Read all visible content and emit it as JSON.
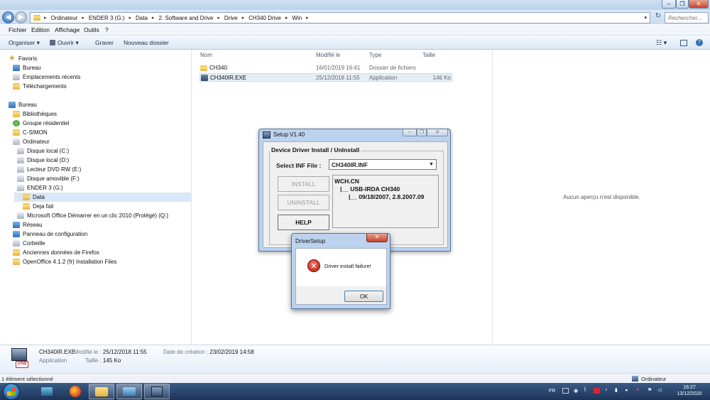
{
  "window": {
    "minimize": "–",
    "maximize": "❐",
    "close": "✕"
  },
  "address": {
    "crumbs": [
      "Ordinateur",
      "ENDER 3 (G:)",
      "Data",
      "2. Software and Drive",
      "Drive",
      "CH340 Drive",
      "Win"
    ],
    "search_placeholder": "Rechercher..."
  },
  "menu": [
    "Fichier",
    "Edition",
    "Affichage",
    "Outils",
    "?"
  ],
  "toolbar": {
    "organiser": "Organiser ▾",
    "ouvrir": "Ouvrir ▾",
    "graver": "Graver",
    "nouveau_dossier": "Nouveau dossier"
  },
  "nav": {
    "favoris": "Favoris",
    "bureau": "Bureau",
    "emplacements": "Emplacements récents",
    "telechargements": "Téléchargements",
    "bureau2": "Bureau",
    "bibliotheques": "Bibliothèques",
    "groupe": "Groupe résidentiel",
    "csimon": "C-SIMON",
    "ordinateur": "Ordinateur",
    "disque_c": "Disque local (C:)",
    "disque_d": "Disque local (D:)",
    "dvd": "Lecteur DVD RW (E:)",
    "amovible": "Disque amovible (F:)",
    "ender": "ENDER 3 (G:)",
    "data": "Data",
    "deja_fait": "Deja fait",
    "office": "Microsoft Office Démarrer en un clic 2010 (Protégé) (Q:)",
    "reseau": "Réseau",
    "panneau": "Panneau de configuration",
    "corbeille": "Corbeille",
    "firefox": "Anciennes données de Firefox",
    "openoffice": "OpenOffice 4.1.2 (fr) Installation Files"
  },
  "columns": {
    "name": "Nom",
    "modified": "Modifié le",
    "type": "Type",
    "size": "Taille"
  },
  "files": [
    {
      "name": "CH340",
      "modified": "16/01/2019 16:41",
      "type": "Dossier de fichiers",
      "size": ""
    },
    {
      "name": "CH340IR.EXE",
      "modified": "25/12/2018 11:55",
      "type": "Application",
      "size": "146 Ko"
    }
  ],
  "preview": {
    "message": "Aucun aperçu n'est disponible."
  },
  "details": {
    "filename": "CH340IR.EXE",
    "modified_label": "Modifié le :",
    "modified_value": "25/12/2018 11:55",
    "created_label": "Date de création :",
    "created_value": "23/02/2019 14:58",
    "type_value": "Application",
    "size_label": "Taille :",
    "size_value": "145 Ko"
  },
  "status": {
    "left": "1 élément sélectionné",
    "right": "Ordinateur"
  },
  "setup": {
    "title": "Setup V1.40",
    "group_title": "Device Driver Install / UnInstall",
    "inf_label": "Select INF File :",
    "inf_value": "CH340IR.INF",
    "install": "INSTALL",
    "uninstall": "UNINSTALL",
    "help": "HELP",
    "tree": [
      "WCH.CN",
      "|__ USB-IRDA CH340",
      "|__ 09/18/2007, 2.8.2007.09"
    ]
  },
  "driver": {
    "title": "DriverSetup",
    "close": "✕",
    "message": "Driver install failure!",
    "ok": "OK"
  },
  "taskbar": {
    "lang": "FR",
    "time": "16:27",
    "date": "13/12/2020"
  }
}
